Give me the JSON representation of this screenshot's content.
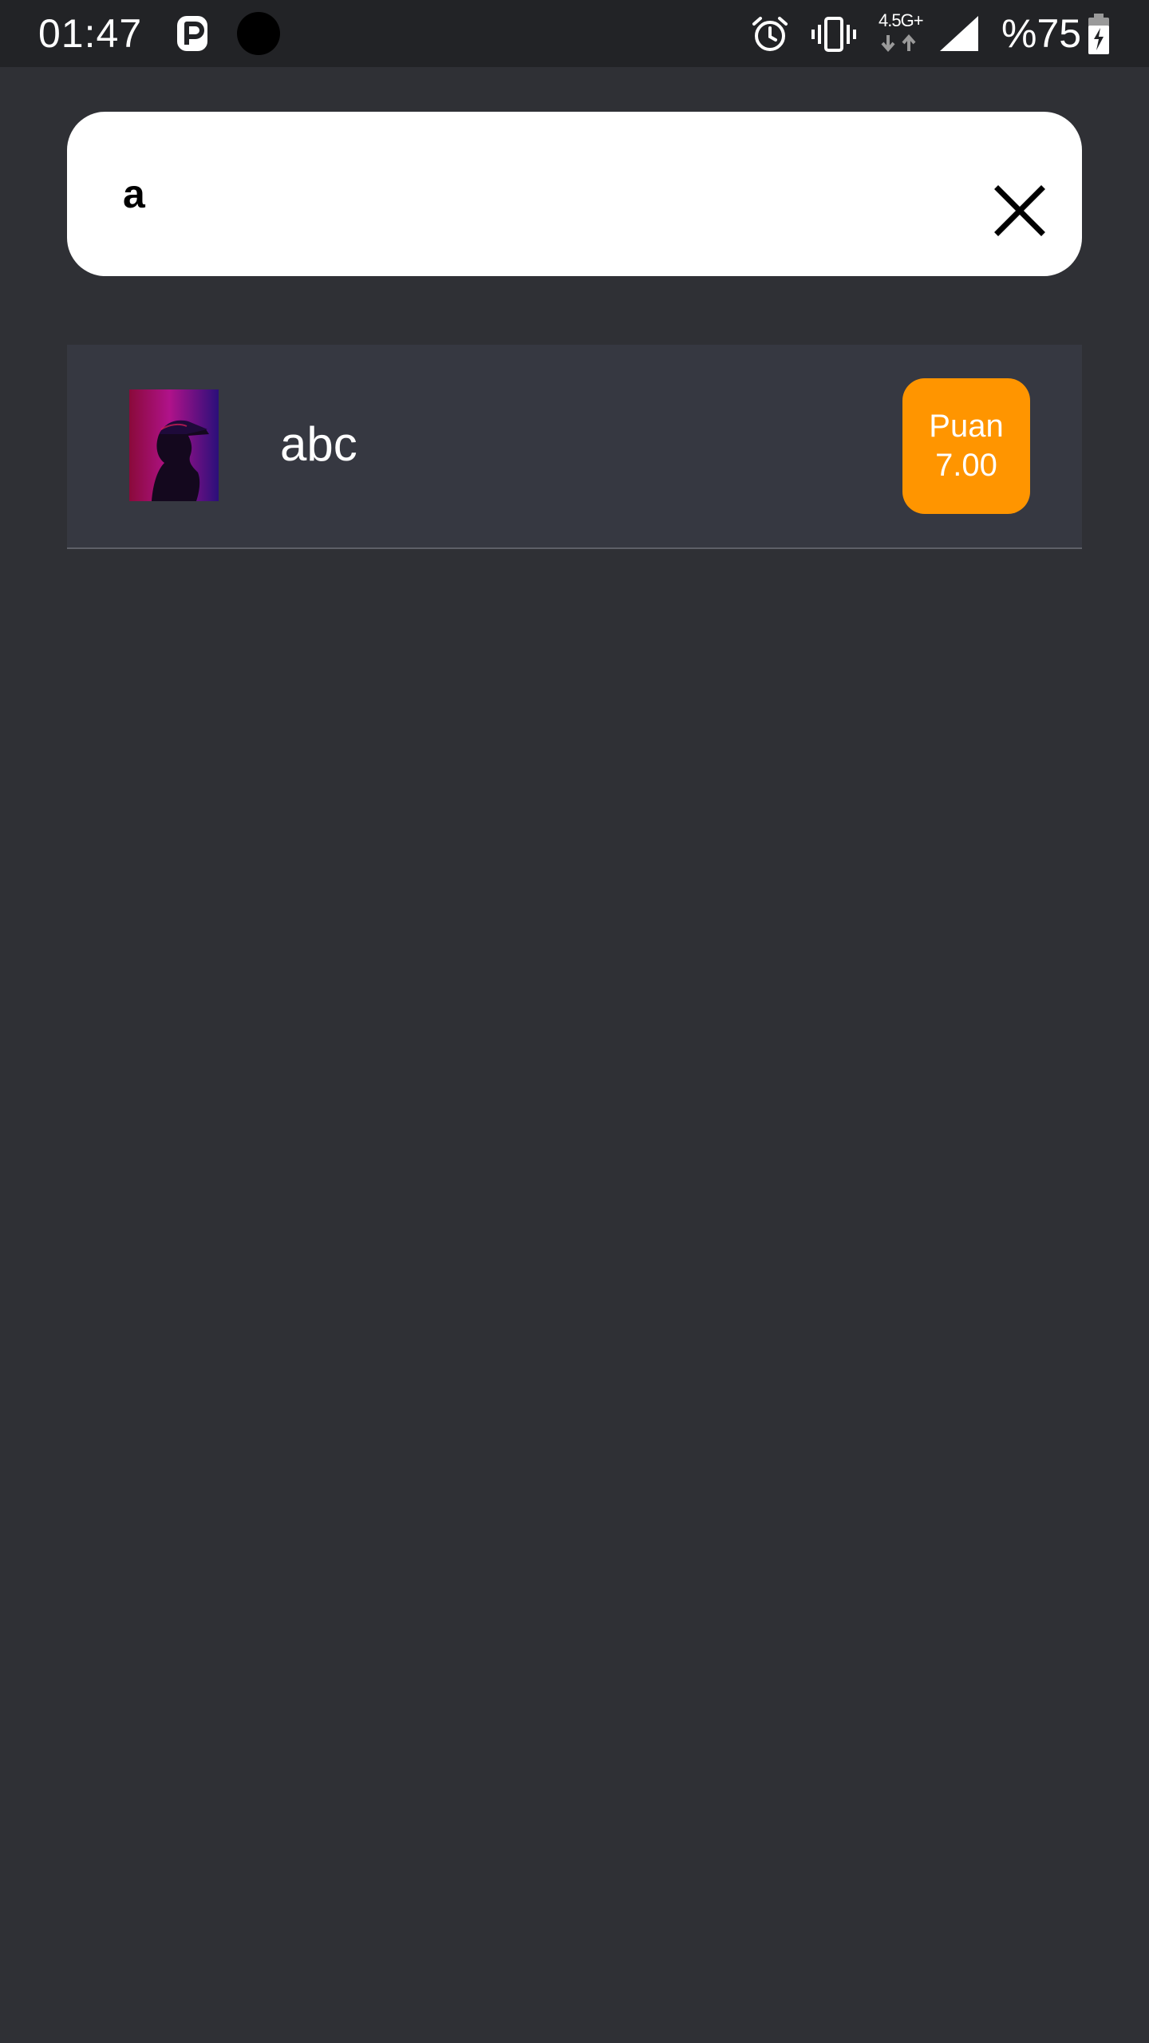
{
  "status_bar": {
    "time": "01:47",
    "network_type": "4.5G+",
    "battery_text": "%75",
    "icons": [
      "p-app-icon",
      "dot-icon",
      "alarm-icon",
      "vibrate-icon",
      "network-arrows-icon",
      "signal-icon",
      "battery-charging-icon"
    ]
  },
  "search": {
    "value": "a",
    "placeholder": "",
    "clear_icon": "close-icon"
  },
  "results": [
    {
      "title": "abc",
      "thumbnail_icon": "thumbnail-image",
      "score_label": "Puan",
      "score_value": "7.00"
    }
  ],
  "colors": {
    "background": "#2f3035",
    "status_bar": "#222326",
    "list_item": "#363841",
    "accent": "#ff9500"
  }
}
